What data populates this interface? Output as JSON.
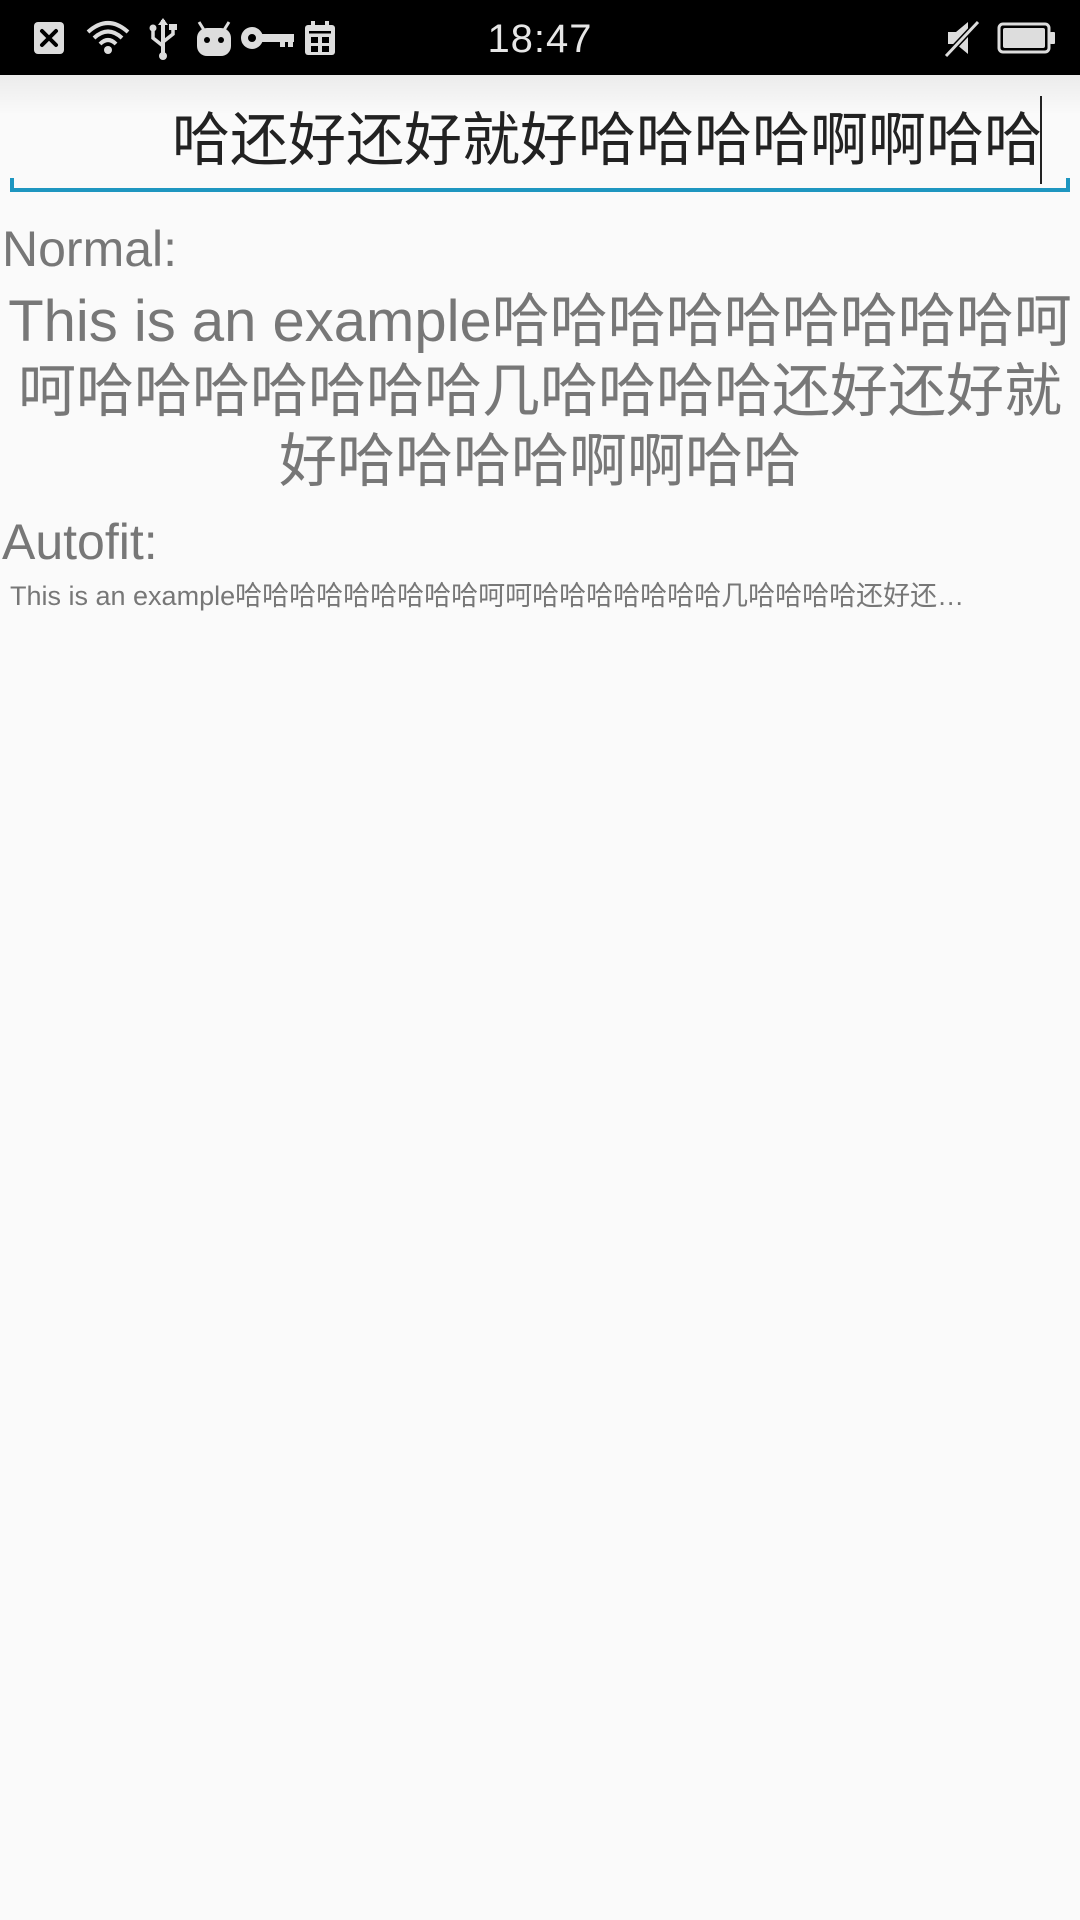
{
  "status_bar": {
    "time": "18:47",
    "icons_left": [
      "close-box-icon",
      "wifi-icon",
      "usb-icon",
      "android-icon",
      "key-icon",
      "calendar-icon"
    ],
    "icons_right": [
      "mute-icon",
      "battery-icon"
    ],
    "icon_color": "#dddddd",
    "background": "#000000"
  },
  "edit": {
    "value": "哈还好还好就好哈哈哈哈啊啊哈哈",
    "underline_color": "#1e96c0"
  },
  "normal": {
    "label": "Normal:",
    "text": "This is an example哈哈哈哈哈哈哈哈哈呵呵哈哈哈哈哈哈哈几哈哈哈哈还好还好就好哈哈哈哈啊啊哈哈"
  },
  "autofit": {
    "label": "Autofit:",
    "text": "This is an example哈哈哈哈哈哈哈哈哈呵呵哈哈哈哈哈哈哈几哈哈哈哈还好还…"
  },
  "colors": {
    "background": "#fafafa",
    "secondary_text": "#777777",
    "primary_text": "#222222",
    "accent": "#1e96c0"
  }
}
